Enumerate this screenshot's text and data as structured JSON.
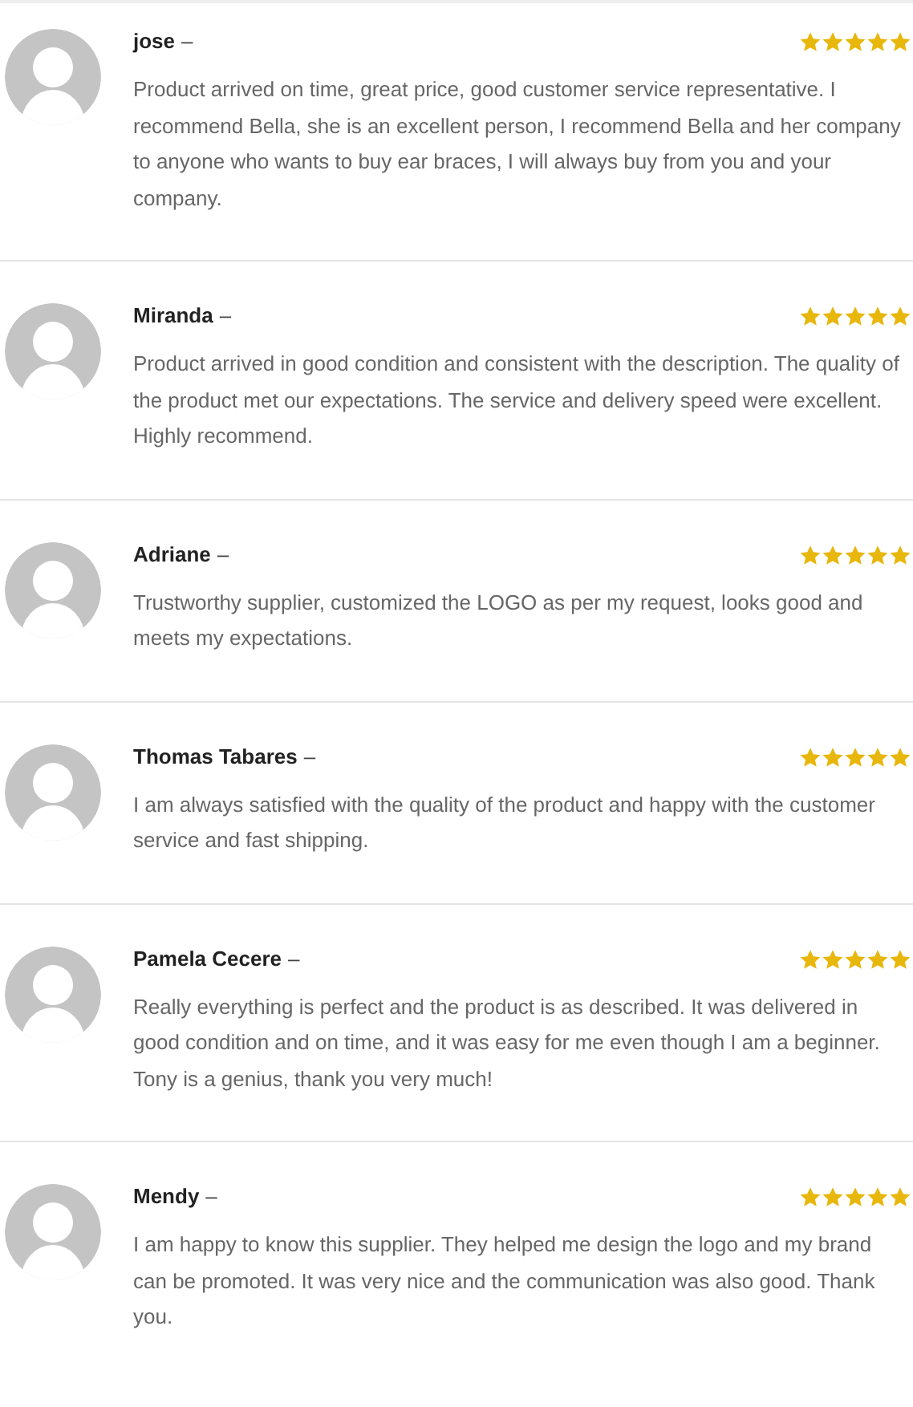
{
  "reviews": [
    {
      "author": "jose",
      "separator": "–",
      "stars": 5,
      "text": "Product arrived on time, great price, good customer service representative. I recommend Bella, she is an excellent person, I recommend Bella and her company to anyone who wants to buy ear braces, I will always buy from you and your company."
    },
    {
      "author": "Miranda",
      "separator": "–",
      "stars": 5,
      "text": "Product arrived in good condition and consistent with the description. The quality of the product met our expectations. The service and delivery speed were excellent. Highly recommend."
    },
    {
      "author": "Adriane",
      "separator": "–",
      "stars": 5,
      "text": "Trustworthy supplier, customized the LOGO as per my request, looks good and meets my expectations."
    },
    {
      "author": "Thomas Tabares",
      "separator": "–",
      "stars": 5,
      "text": "I am always satisfied with the quality of the product and happy with the customer service and fast shipping."
    },
    {
      "author": "Pamela Cecere",
      "separator": "–",
      "stars": 5,
      "text": "Really everything is perfect and the product is as described. It was delivered in good condition and on time, and it was easy for me even though I am a beginner. Tony is a genius, thank you very much!"
    },
    {
      "author": "Mendy",
      "separator": "–",
      "stars": 5,
      "text": "I am happy to know this supplier. They helped me design the logo and my brand can be promoted. It was very nice and the communication was also good. Thank you."
    }
  ]
}
